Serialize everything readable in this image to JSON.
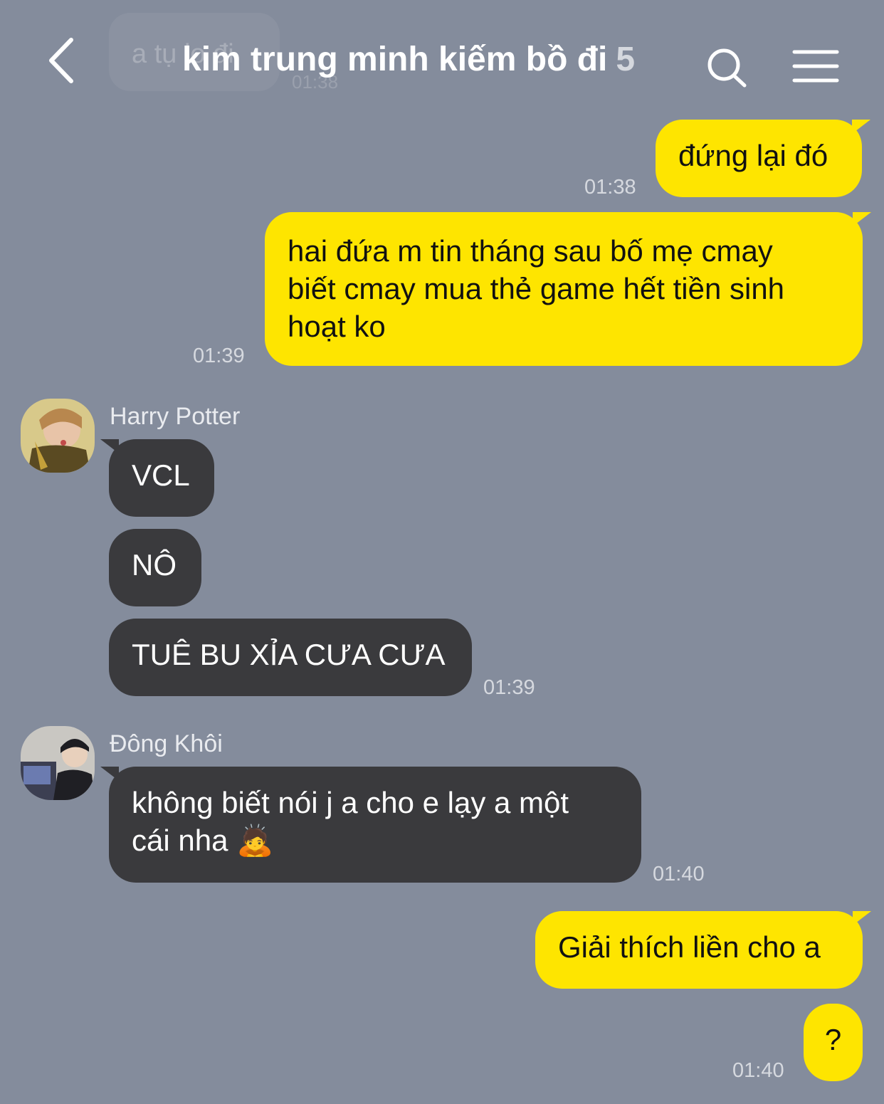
{
  "header": {
    "back_icon": "chevron-left-icon",
    "ghost_text": "a tụ lo đi",
    "ghost_time": "01:38",
    "title": "kim trung minh kiếm bồ đi",
    "member_count": "5",
    "search_icon": "search-icon",
    "menu_icon": "hamburger-menu-icon"
  },
  "messages": [
    {
      "side": "mine",
      "text": "đứng lại đó",
      "time": "01:38"
    },
    {
      "side": "mine",
      "lines": [
        "hai đứa m tin tháng sau bố mẹ cmay",
        "biết cmay mua thẻ game hết tiền sinh",
        "hoạt ko"
      ],
      "time": "01:39"
    },
    {
      "side": "theirs",
      "sender": "Harry Potter",
      "items": [
        "VCL",
        "NÔ",
        "TUÊ BU XỈA CƯA CƯA"
      ],
      "time": "01:39"
    },
    {
      "side": "theirs",
      "sender": "Đông Khôi",
      "lines": [
        "không biết nói j a cho e lạy a một",
        "cái nha 🙇"
      ],
      "time": "01:40"
    },
    {
      "side": "mine",
      "text": "Giải thích liền cho a"
    },
    {
      "side": "mine",
      "text": "?",
      "time": "01:40"
    }
  ],
  "colors": {
    "background": "#848c9c",
    "mine_bubble": "#fee500",
    "theirs_bubble": "#3a3a3d"
  }
}
